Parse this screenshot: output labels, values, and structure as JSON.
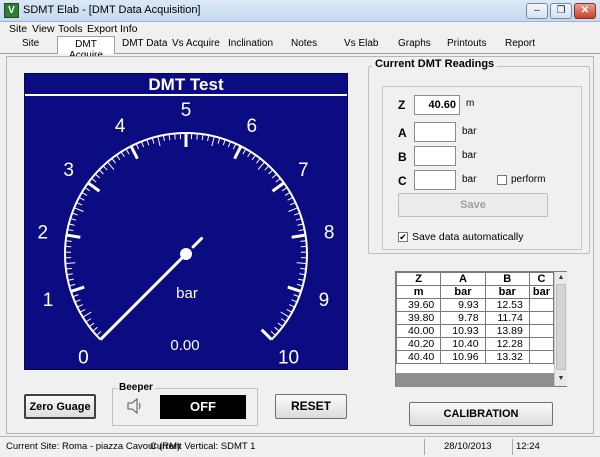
{
  "window": {
    "title": "SDMT Elab - [DMT Data Acquisition]",
    "app_icon_letter": "V",
    "minimize_glyph": "–",
    "restore_glyph": "❐",
    "close_glyph": "✕"
  },
  "menu": [
    "Site",
    "View",
    "Tools",
    "Export",
    "Info"
  ],
  "tabs": [
    "Site",
    "DMT Acquire",
    "DMT Data",
    "Vs Acquire",
    "Inclination",
    "Notes",
    "Vs Elab",
    "Graphs",
    "Printouts",
    "Report"
  ],
  "gauge": {
    "title": "DMT Test",
    "scale_labels": [
      "0",
      "1",
      "2",
      "3",
      "4",
      "5",
      "6",
      "7",
      "8",
      "9",
      "10"
    ],
    "scale_min": 0,
    "scale_max": 10,
    "value": 0,
    "value_text": "0.00",
    "unit": "bar"
  },
  "readings": {
    "legend": "Current DMT Readings",
    "z_label": "Z",
    "z_value": "40.60",
    "z_unit": "m",
    "a_label": "A",
    "a_value": "",
    "a_unit": "bar",
    "b_label": "B",
    "b_value": "",
    "b_unit": "bar",
    "c_label": "C",
    "c_value": "",
    "c_unit": "bar",
    "perform_label": "perform",
    "perform_checked": false,
    "save_label": "Save",
    "autosave_label": "Save data automatically",
    "autosave_checked": true
  },
  "table": {
    "columns": [
      "Z",
      "A",
      "B",
      "C"
    ],
    "units": [
      "m",
      "bar",
      "bar",
      "bar"
    ],
    "rows": [
      [
        "39.60",
        "9.93",
        "12.53",
        ""
      ],
      [
        "39.80",
        "9.78",
        "11.74",
        ""
      ],
      [
        "40.00",
        "10.93",
        "13.89",
        ""
      ],
      [
        "40.20",
        "10.40",
        "12.28",
        ""
      ],
      [
        "40.40",
        "10.96",
        "13.32",
        ""
      ]
    ]
  },
  "buttons": {
    "zero_gauge": "Zero Guage",
    "reset": "RESET",
    "calibration": "CALIBRATION"
  },
  "beeper": {
    "legend": "Beeper",
    "state": "OFF"
  },
  "status": {
    "site": "Current Site: Roma - piazza Cavour (RM)",
    "vertical": "Current Vertical: SDMT 1",
    "date": "28/10/2013",
    "time": "12:24"
  },
  "colors": {
    "gauge_background": "#0b0b82",
    "gauge_foreground": "#ffffff"
  }
}
